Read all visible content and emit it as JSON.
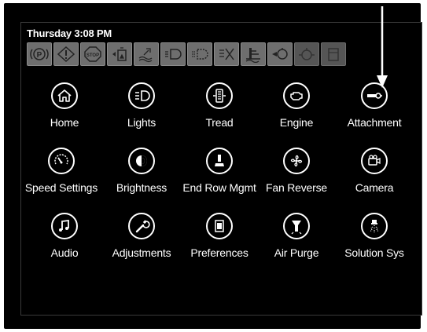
{
  "header": {
    "datetime": "Thursday 3:08 PM"
  },
  "status_icons": [
    {
      "name": "parking-brake-icon",
      "glyph": "(P)"
    },
    {
      "name": "warning-icon",
      "glyph": "!"
    },
    {
      "name": "stop-icon",
      "glyph": "STOP"
    },
    {
      "name": "tank-level-icon",
      "glyph": ""
    },
    {
      "name": "water-temp-icon",
      "glyph": ""
    },
    {
      "name": "left-turn-signal-icon",
      "glyph": ""
    },
    {
      "name": "right-turn-signal-icon",
      "glyph": ""
    },
    {
      "name": "high-beam-off-icon",
      "glyph": ""
    },
    {
      "name": "hydraulic-icon",
      "glyph": ""
    },
    {
      "name": "engine-oil-icon",
      "glyph": ""
    },
    {
      "name": "filter-icon",
      "glyph": ""
    },
    {
      "name": "fuel-icon",
      "glyph": ""
    }
  ],
  "menu": {
    "items": [
      {
        "label": "Home",
        "icon": "home-icon"
      },
      {
        "label": "Lights",
        "icon": "lights-icon"
      },
      {
        "label": "Tread",
        "icon": "tread-icon"
      },
      {
        "label": "Engine",
        "icon": "engine-icon"
      },
      {
        "label": "Attachment",
        "icon": "attachment-icon"
      },
      {
        "label": "Speed Settings",
        "icon": "speedometer-icon"
      },
      {
        "label": "Brightness",
        "icon": "brightness-icon"
      },
      {
        "label": "End Row Mgmt",
        "icon": "joystick-icon"
      },
      {
        "label": "Fan Reverse",
        "icon": "fan-icon"
      },
      {
        "label": "Camera",
        "icon": "camera-icon"
      },
      {
        "label": "Audio",
        "icon": "music-note-icon"
      },
      {
        "label": "Adjustments",
        "icon": "wrench-icon"
      },
      {
        "label": "Preferences",
        "icon": "document-icon"
      },
      {
        "label": "Air Purge",
        "icon": "air-purge-icon"
      },
      {
        "label": "Solution Sys",
        "icon": "sprayer-icon"
      }
    ]
  },
  "colors": {
    "background": "#000000",
    "text": "#ffffff",
    "status_icon_bg": "#6e6e6e"
  }
}
